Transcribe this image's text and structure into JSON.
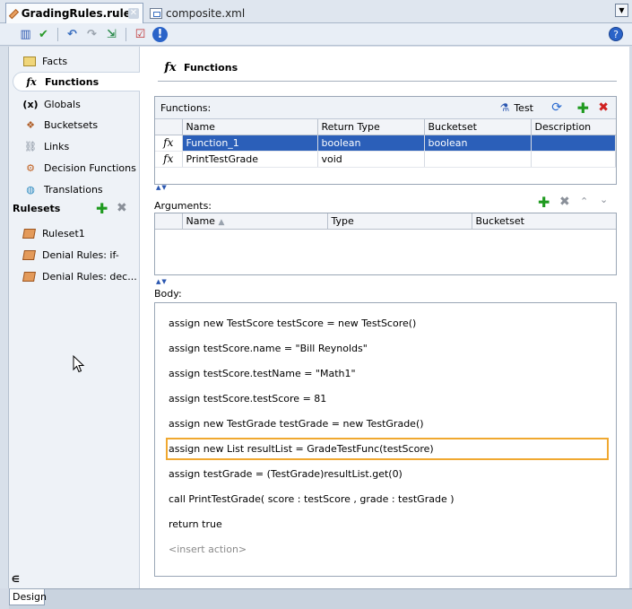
{
  "tabs": [
    {
      "label": "GradingRules.rules",
      "active": true
    },
    {
      "label": "composite.xml",
      "active": false
    }
  ],
  "nav": {
    "items": [
      {
        "label": "Facts",
        "icon": "facts-icon"
      },
      {
        "label": "Functions",
        "icon": "fx-icon",
        "selected": true
      },
      {
        "label": "Globals",
        "icon": "globals-icon"
      },
      {
        "label": "Bucketsets",
        "icon": "bucketset-icon"
      },
      {
        "label": "Links",
        "icon": "link-icon"
      },
      {
        "label": "Decision Functions",
        "icon": "decision-function-icon"
      },
      {
        "label": "Translations",
        "icon": "translation-icon"
      }
    ],
    "rulesets_label": "Rulesets",
    "rulesets": [
      "Ruleset1",
      "Denial Rules: if-",
      "Denial Rules: dec..."
    ]
  },
  "main": {
    "title": "Functions",
    "functions_label": "Functions:",
    "test_label": "Test",
    "functions_columns": [
      "Name",
      "Return Type",
      "Bucketset",
      "Description"
    ],
    "functions_rows": [
      {
        "name": "Function_1",
        "return_type": "boolean",
        "bucketset": "boolean",
        "description": ""
      },
      {
        "name": "PrintTestGrade",
        "return_type": "void",
        "bucketset": "",
        "description": ""
      }
    ],
    "arguments_label": "Arguments:",
    "arguments_columns": [
      "Name",
      "Type",
      "Bucketset"
    ],
    "body_label": "Body:",
    "body_lines": [
      "assign new TestScore testScore = new TestScore()",
      "assign testScore.name = \"Bill Reynolds\"",
      "assign testScore.testName = \"Math1\"",
      "assign testScore.testScore = 81",
      "assign new TestGrade testGrade = new TestGrade()",
      "assign new List resultList = GradeTestFunc(testScore)",
      "assign testGrade = (TestGrade)resultList.get(0)",
      "call PrintTestGrade( score : testScore , grade : testGrade )",
      "return true"
    ],
    "body_placeholder": "<insert action>"
  },
  "bottom": {
    "design_tab": "Design"
  },
  "colors": {
    "selection": "#2b5fb9",
    "highlight_border": "#f0a830",
    "add_green": "#1f9a1f",
    "delete_red": "#d02020"
  }
}
